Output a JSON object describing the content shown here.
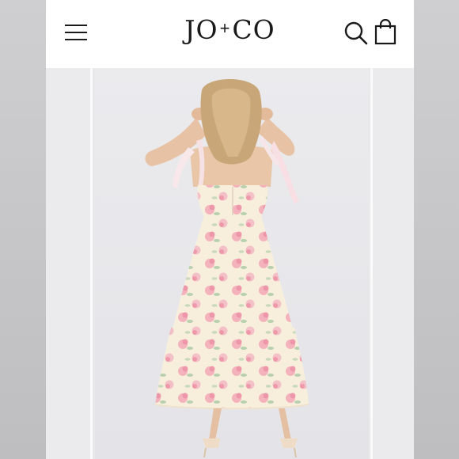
{
  "brand": {
    "logo_left": "JO",
    "logo_plus": "+",
    "logo_right": "CO"
  },
  "header": {
    "menu_icon": "hamburger-menu-icon",
    "search_icon": "search-icon",
    "bag_icon": "shopping-bag-icon"
  },
  "gallery": {
    "image": "product-photo-floral-maxi-dress-back-view",
    "colors": {
      "dress": "#f7efdc",
      "flower": "#f2a7b6",
      "leaf": "#a9c8a2"
    }
  }
}
